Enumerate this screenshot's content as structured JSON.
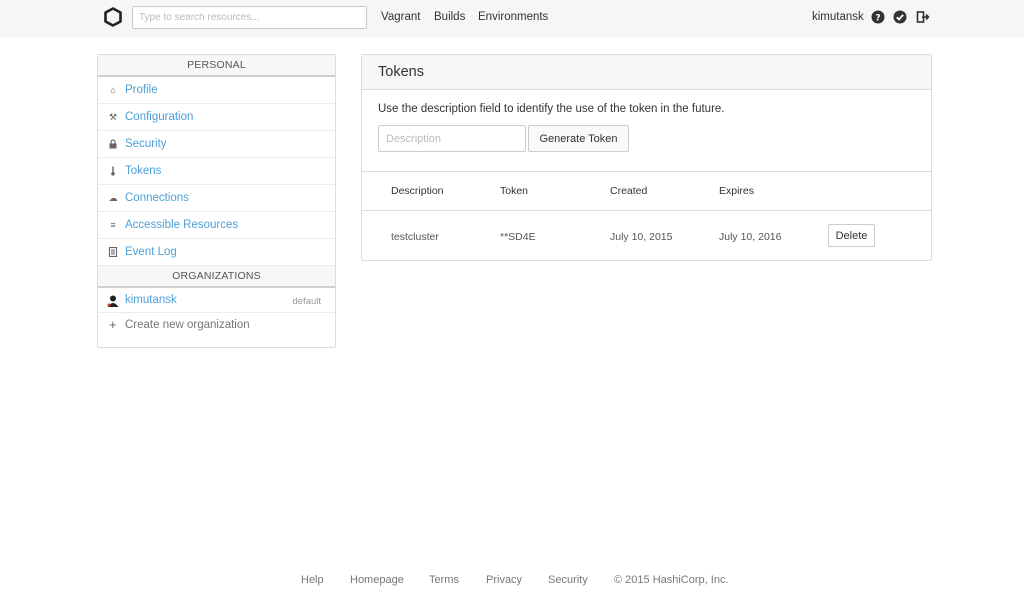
{
  "header": {
    "logo_icon": "hashicorp-logo-icon",
    "search_placeholder": "Type to search resources...",
    "nav": [
      "Vagrant",
      "Builds",
      "Environments"
    ],
    "username": "kimutansk",
    "icons": [
      "help-icon",
      "check-icon",
      "logout-icon"
    ]
  },
  "sidebar": {
    "personal_heading": "PERSONAL",
    "items": [
      {
        "label": "Profile",
        "icon": "home-icon"
      },
      {
        "label": "Configuration",
        "icon": "wrench-icon"
      },
      {
        "label": "Security",
        "icon": "lock-icon"
      },
      {
        "label": "Tokens",
        "icon": "thermometer-icon"
      },
      {
        "label": "Connections",
        "icon": "cloud-icon"
      },
      {
        "label": "Accessible Resources",
        "icon": "list-icon"
      },
      {
        "label": "Event Log",
        "icon": "log-icon"
      }
    ],
    "organizations_heading": "ORGANIZATIONS",
    "organization": {
      "name": "kimutansk",
      "tag": "default",
      "icon": "user-avatar-icon"
    },
    "create_label": "Create new organization"
  },
  "main": {
    "title": "Tokens",
    "description": "Use the description field to identify the use of the token in the future.",
    "input_placeholder": "Description",
    "generate_label": "Generate Token",
    "table": {
      "headers": [
        "Description",
        "Token",
        "Created",
        "Expires"
      ],
      "rows": [
        {
          "description": "testcluster",
          "token": "**SD4E",
          "created": "July 10, 2015",
          "expires": "July 10, 2016",
          "action": "Delete"
        }
      ]
    }
  },
  "footer": {
    "links": [
      "Help",
      "Homepage",
      "Terms",
      "Privacy",
      "Security"
    ],
    "copyright": "© 2015 HashiCorp, Inc."
  }
}
